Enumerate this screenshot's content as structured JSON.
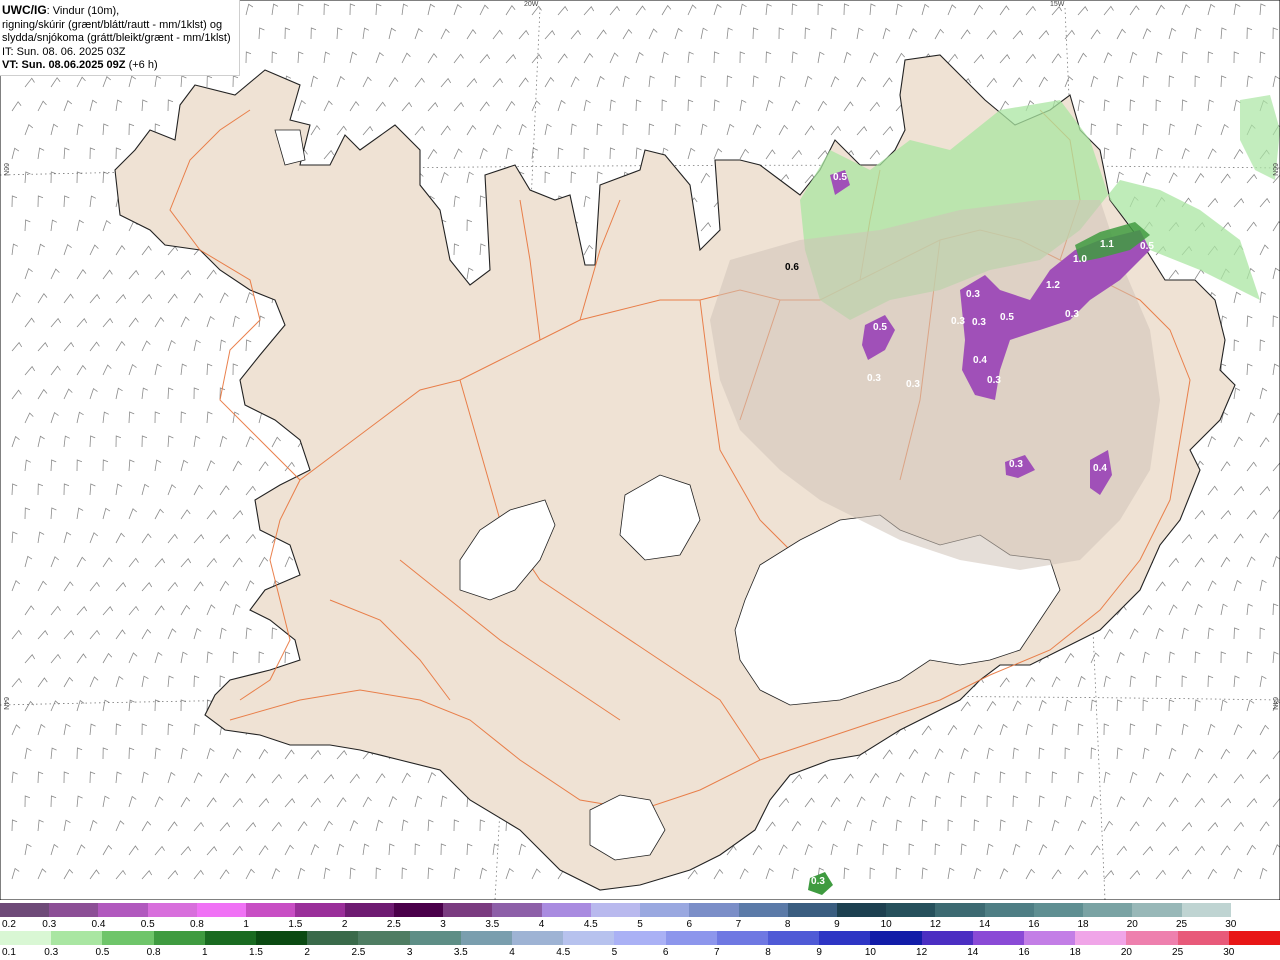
{
  "header": {
    "title": "UWC/IG",
    "title_rest": ": Vindur (10m),",
    "line2": "rigning/skúrir (grænt/blátt/rautt - mm/1klst) og",
    "line3": "slydda/snjókoma (grátt/bleikt/grænt - mm/1klst)",
    "it": "IT: Sun. 08. 06. 2025 03Z",
    "vt_bold": "VT: Sun. 08.06.2025 09Z",
    "vt_rest": " (+6 h)"
  },
  "graticule": {
    "lon_labels": [
      "20W",
      "15W"
    ],
    "lat_labels": [
      "66N",
      "64N"
    ]
  },
  "map_labels": [
    "0.5",
    "0.6",
    "0.3",
    "0.3",
    "0.3",
    "0.5",
    "0.4",
    "0.3",
    "1.2",
    "0.5",
    "0.3",
    "1.0",
    "1.1",
    "0.5",
    "0.3",
    "0.3",
    "0.4",
    "0.3",
    "0.3"
  ],
  "colors": {
    "land": "#efe2d4",
    "coast": "#222222",
    "roads": "#e8743b",
    "glacier": "#ffffff",
    "wind_barb": "#888888",
    "snow": "#a050b8",
    "rain": "#8ee08e"
  },
  "legend_snow": {
    "labels": [
      "0.2",
      "0.3",
      "0.4",
      "0.5",
      "0.8",
      "1",
      "1.5",
      "2",
      "2.5",
      "3",
      "3.5",
      "4",
      "4.5",
      "5",
      "6",
      "7",
      "8",
      "9",
      "10",
      "12",
      "14",
      "16",
      "18",
      "20",
      "25",
      "30"
    ],
    "colors": [
      "#6e4a78",
      "#8c4f96",
      "#b159be",
      "#d86fdc",
      "#f072f5",
      "#c84ec4",
      "#9a2f9a",
      "#6e1b72",
      "#4a004a",
      "#7a3b80",
      "#8d5fa8",
      "#a98be0",
      "#b9b9ee",
      "#9aa8e0",
      "#7b8ec8",
      "#5b7aa8",
      "#3a5d80",
      "#1d4050",
      "#26505c",
      "#3c6a72",
      "#4e7e84",
      "#5f8f92",
      "#7aa3a4",
      "#98b8b8",
      "#bfd4d2",
      "#ffffff"
    ]
  },
  "legend_rain": {
    "labels": [
      "0.1",
      "0.3",
      "0.5",
      "0.8",
      "1",
      "1.5",
      "2",
      "2.5",
      "3",
      "3.5",
      "4",
      "4.5",
      "5",
      "6",
      "7",
      "8",
      "9",
      "10",
      "12",
      "14",
      "16",
      "18",
      "20",
      "25",
      "30"
    ],
    "colors": [
      "#d9f7d4",
      "#a9e6a2",
      "#6fc56a",
      "#3f9b40",
      "#1a6b21",
      "#0b4a12",
      "#3a6a4a",
      "#4f7d63",
      "#5e8e86",
      "#7a9eae",
      "#9eb3d4",
      "#b7c2ee",
      "#aab1f5",
      "#8d96ec",
      "#6f78e2",
      "#4f5ad6",
      "#2e35c4",
      "#121ca8",
      "#4b2ec2",
      "#8a4ad6",
      "#c37ee6",
      "#f0a5e8",
      "#ee80ae",
      "#e85a7a",
      "#e81616"
    ]
  }
}
